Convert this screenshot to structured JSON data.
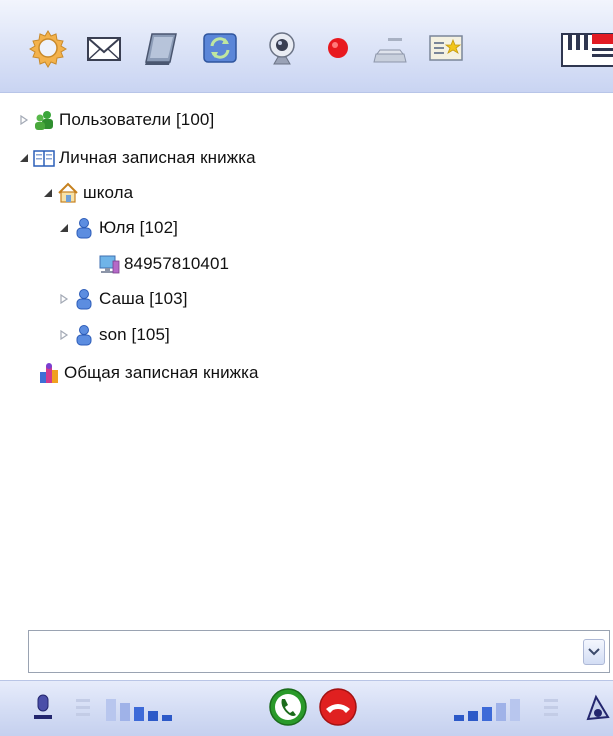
{
  "toolbar": {
    "icons": [
      "gear-icon",
      "mail-icon",
      "notebook-icon",
      "refresh-icon",
      "webcam-icon",
      "record-icon",
      "keyboard-icon",
      "contact-card-icon",
      "flag-icon"
    ]
  },
  "tree": {
    "nodes": [
      {
        "label": "Пользователи [100]",
        "icon": "users-group-icon",
        "state": "collapsed"
      },
      {
        "label": "Личная записная книжка",
        "icon": "address-book-icon",
        "state": "expanded"
      },
      {
        "label": "школа",
        "icon": "home-folder-icon",
        "state": "expanded"
      },
      {
        "label": "Юля [102]",
        "icon": "user-icon",
        "state": "expanded"
      },
      {
        "label": "84957810401",
        "icon": "computer-icon",
        "state": "leaf"
      },
      {
        "label": "Саша [103]",
        "icon": "user-icon",
        "state": "collapsed"
      },
      {
        "label": "son [105]",
        "icon": "user-icon",
        "state": "collapsed"
      },
      {
        "label": "Общая записная книжка",
        "icon": "shared-book-icon",
        "state": "leaf"
      }
    ]
  },
  "combo": {
    "value": "",
    "placeholder": ""
  },
  "bottom": {
    "icons": [
      "microphone-icon",
      "volume-slider-icon",
      "mic-level-icon",
      "call-button-icon",
      "hangup-button-icon",
      "speaker-level-icon",
      "speaker-slider-icon",
      "speaker-icon"
    ],
    "colors": {
      "call": "#2a9a2a",
      "hangup": "#e02020"
    }
  }
}
